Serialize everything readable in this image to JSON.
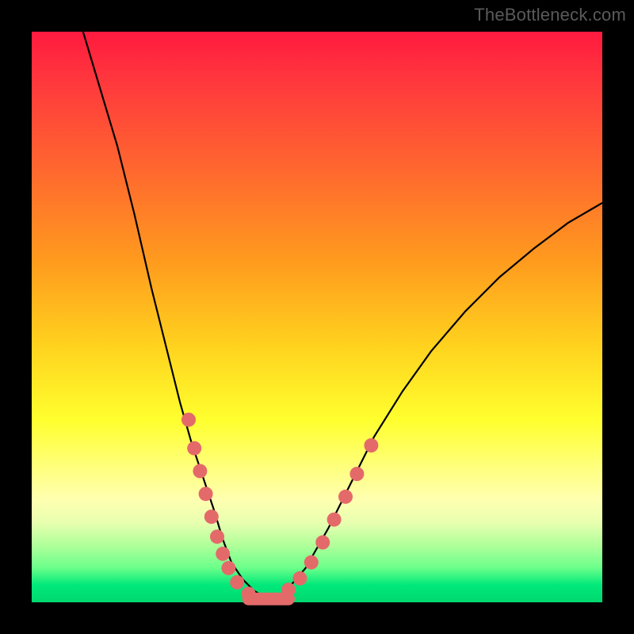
{
  "watermark": "TheBottleneck.com",
  "colors": {
    "frame_bg": "#000000",
    "gradient_top": "#ff1a3f",
    "gradient_bottom": "#00d86f",
    "curve_stroke": "#000000",
    "marker_fill": "#e46a6a"
  },
  "chart_data": {
    "type": "line",
    "title": "",
    "xlabel": "",
    "ylabel": "",
    "xlim": [
      0,
      100
    ],
    "ylim": [
      0,
      100
    ],
    "grid": false,
    "legend": false,
    "series": [
      {
        "name": "curve",
        "x": [
          9,
          12,
          15,
          18,
          21,
          24,
          26,
          28,
          30,
          32,
          33.5,
          35,
          37,
          39,
          41,
          43,
          45,
          48,
          52,
          56,
          60,
          65,
          70,
          76,
          82,
          88,
          94,
          100
        ],
        "y": [
          100,
          90,
          80,
          68,
          55,
          43,
          35,
          28,
          22,
          16,
          11,
          7,
          4,
          2,
          0.8,
          0.8,
          2.5,
          6,
          13,
          21,
          29,
          37,
          44,
          51,
          57,
          62,
          66.5,
          70
        ]
      }
    ],
    "markers": [
      {
        "x": 27.5,
        "y": 32
      },
      {
        "x": 28.5,
        "y": 27
      },
      {
        "x": 29.5,
        "y": 23
      },
      {
        "x": 30.5,
        "y": 19
      },
      {
        "x": 31.5,
        "y": 15
      },
      {
        "x": 32.5,
        "y": 11.5
      },
      {
        "x": 33.5,
        "y": 8.5
      },
      {
        "x": 34.5,
        "y": 6
      },
      {
        "x": 36,
        "y": 3.5
      },
      {
        "x": 38,
        "y": 1.5
      },
      {
        "x": 45,
        "y": 2.2
      },
      {
        "x": 47,
        "y": 4.2
      },
      {
        "x": 49,
        "y": 7
      },
      {
        "x": 51,
        "y": 10.5
      },
      {
        "x": 53,
        "y": 14.5
      },
      {
        "x": 55,
        "y": 18.5
      },
      {
        "x": 57,
        "y": 22.5
      },
      {
        "x": 59.5,
        "y": 27.5
      }
    ],
    "flat_band": {
      "x1": 38,
      "x2": 45,
      "y": 0.6
    }
  }
}
